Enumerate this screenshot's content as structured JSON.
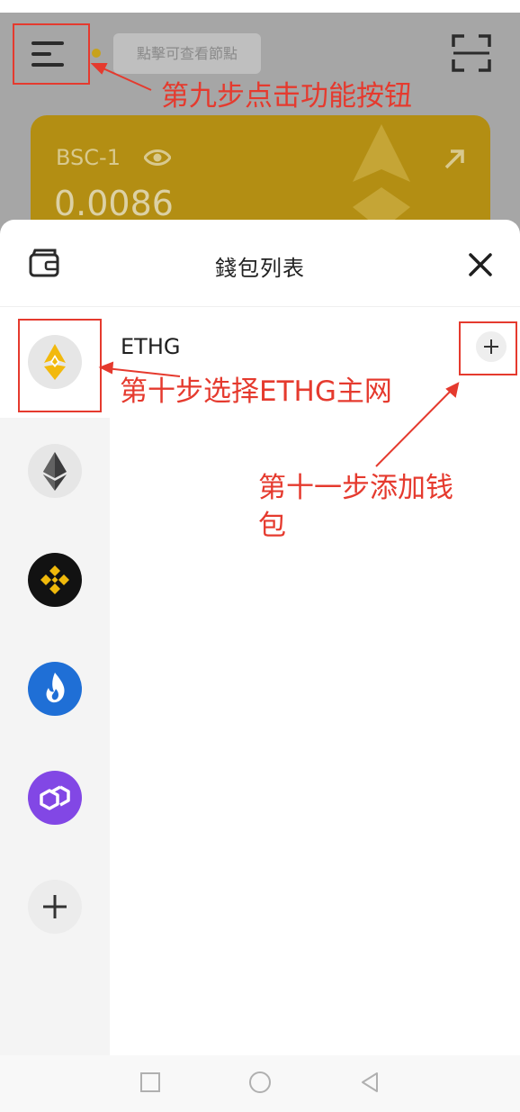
{
  "background": {
    "tooltip": "點擊可查看節點",
    "card": {
      "network": "BSC-1",
      "balance": "0.0086",
      "color": "#b38e13"
    }
  },
  "sheet": {
    "title": "錢包列表",
    "selected_chain": {
      "name": "ETHG"
    },
    "chains": [
      {
        "icon": "ethg-icon"
      },
      {
        "icon": "ethereum-icon"
      },
      {
        "icon": "bnb-icon"
      },
      {
        "icon": "huobi-heco-icon"
      },
      {
        "icon": "polygon-icon"
      }
    ]
  },
  "annotations": {
    "step9": "第九步点击功能按钮",
    "step10": "第十步选择ETHG主网",
    "step11_line1": "第十一步添加钱",
    "step11_line2": "包",
    "color": "#e53a2e"
  }
}
